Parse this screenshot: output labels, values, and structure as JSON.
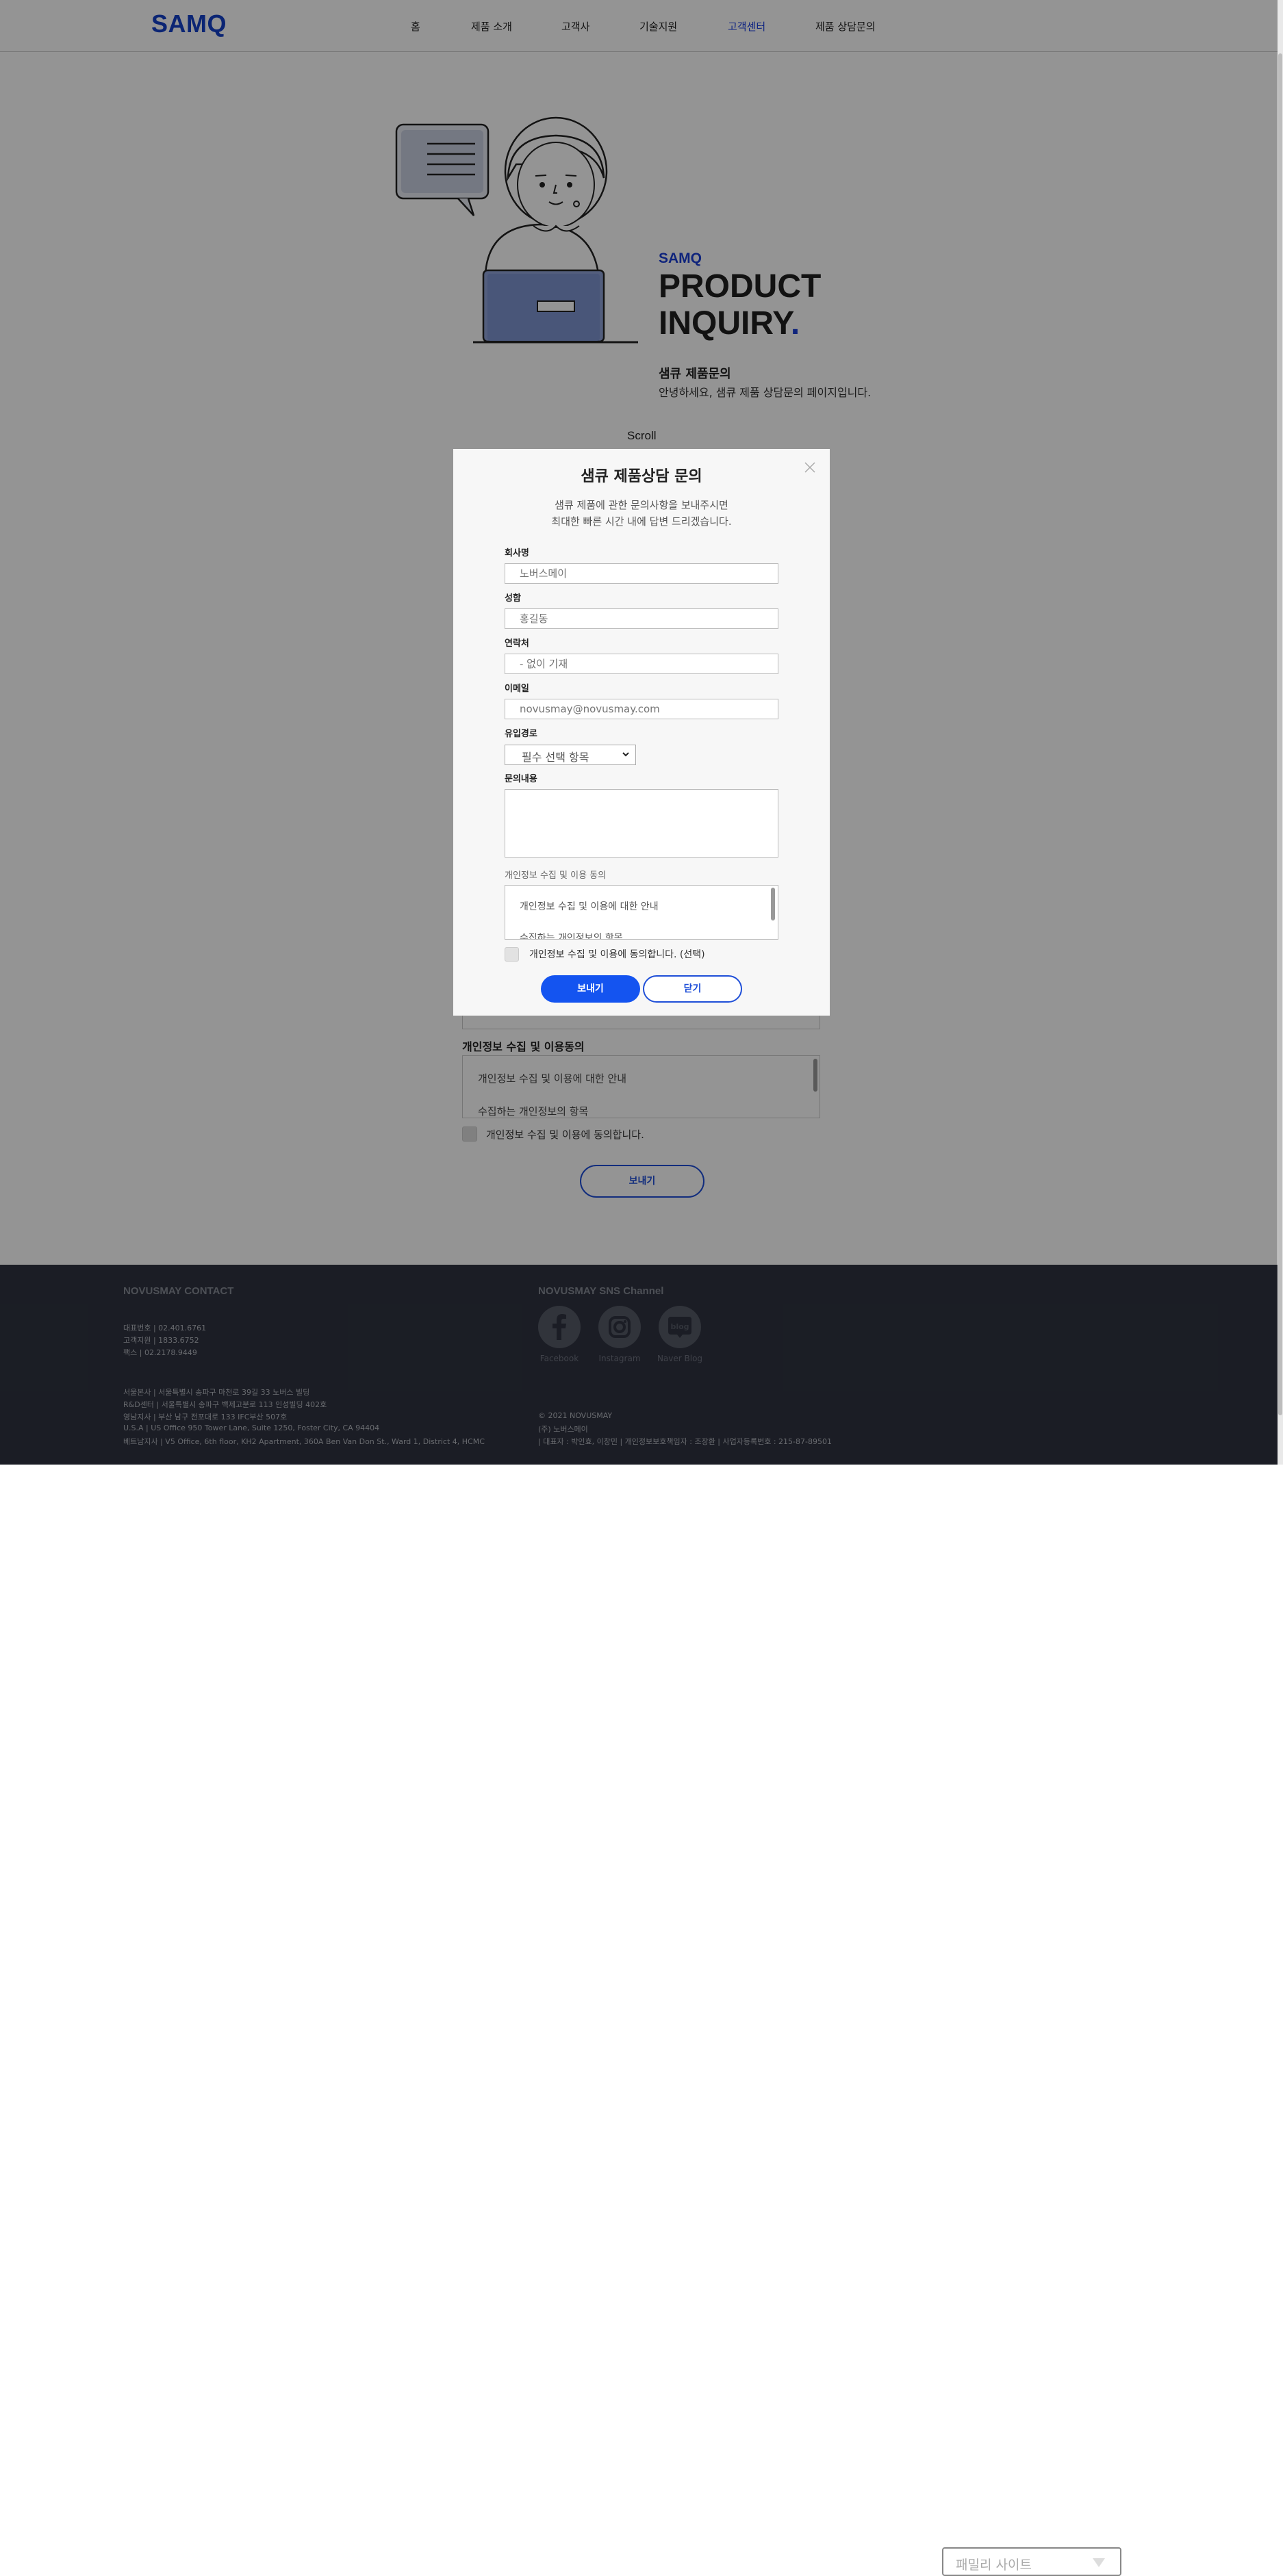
{
  "header": {
    "logo": "SAMQ",
    "nav": [
      {
        "label": "홈"
      },
      {
        "label": "제품 소개"
      },
      {
        "label": "고객사"
      },
      {
        "label": "기술지원"
      },
      {
        "label": "고객센터",
        "active": true
      },
      {
        "label": "제품 상담문의"
      }
    ]
  },
  "hero": {
    "brand": "SAMQ",
    "title_line1": "PRODUCT",
    "title_line2": "INQUIRY",
    "title_dot": ".",
    "heading": "샘큐 제품문의",
    "description": "안녕하세요, 샘큐 제품 상담문의 페이지입니다.",
    "scroll_label": "Scroll"
  },
  "background_form": {
    "privacy_label": "개인정보 수집 및 이용동의",
    "privacy_line1": "개인정보 수집 및 이용에 대한 안내",
    "privacy_line2": "수집하는 개인정보의 항목",
    "agree_label": "개인정보 수집 및 이용에 동의합니다.",
    "send_label": "보내기"
  },
  "modal": {
    "title": "샘큐 제품상담 문의",
    "desc_line1": "샘큐 제품에 관한 문의사항을 보내주시면",
    "desc_line2": "최대한 빠른 시간 내에 답변 드리겠습니다.",
    "fields": {
      "company": {
        "label": "회사명",
        "placeholder": "노버스메이"
      },
      "name": {
        "label": "성함",
        "placeholder": "홍길동"
      },
      "phone": {
        "label": "연락처",
        "placeholder": "- 없이 기재"
      },
      "email": {
        "label": "이메일",
        "placeholder": "novusmay@novusmay.com"
      },
      "source": {
        "label": "유입경로",
        "selected": "필수 선택 항목"
      },
      "message": {
        "label": "문의내용"
      }
    },
    "privacy_label": "개인정보 수집 및 이용 동의",
    "privacy_line1": "개인정보 수집 및 이용에 대한 안내",
    "privacy_line2": "수집하는 개인정보의 항목",
    "agree_label": "개인정보 수집 및 이용에 동의합니다. (선택)",
    "send_label": "보내기",
    "close_label": "닫기"
  },
  "footer": {
    "contact_title": "NOVUSMAY CONTACT",
    "contacts": [
      "대표번호  |   02.401.6761",
      "고객지원  |   1833.6752",
      "팩스  |   02.2178.9449"
    ],
    "addresses": [
      "서울본사  |   서울특별시 송파구 마천로 39길 33 노버스 빌딩",
      "R&D센터  |   서울특별시 송파구 백제고분로 113 인성빌딩 402호",
      "영남지사  |   부산 남구 전포대로 133 IFC부산 507호",
      "U.S.A  |   US Office 950 Tower Lane, Suite 1250, Foster City, CA 94404",
      "베트남지사  |   V5 Office, 6th floor, KH2 Apartment, 360A Ben Van Don St., Ward 1, District 4, HCMC"
    ],
    "sns_title": "NOVUSMAY SNS Channel",
    "sns": [
      {
        "label": "Facebook",
        "icon": "facebook-icon"
      },
      {
        "label": "Instagram",
        "icon": "instagram-icon"
      },
      {
        "label": "Naver Blog",
        "icon": "blog-icon"
      }
    ],
    "copyright": "© 2021 NOVUSMAY",
    "company": "(주) 노버스메이",
    "legal": "|  대표자 : 박인효, 이창민   |   개인정보보호책임자 : 조장환   |   사업자등록번호 : 215-87-89501",
    "family_site": "패밀리 사이트"
  }
}
